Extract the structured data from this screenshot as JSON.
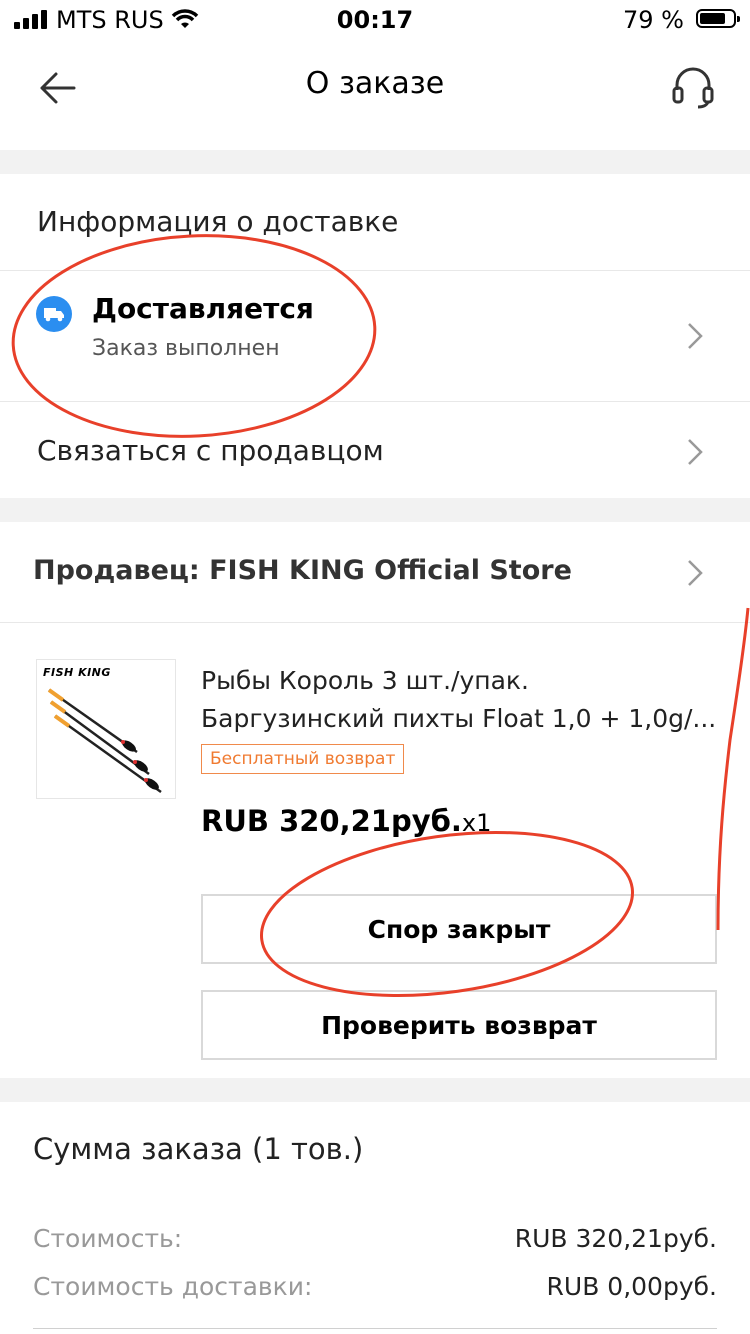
{
  "status_bar": {
    "carrier": "MTS RUS",
    "time": "00:17",
    "battery": "79 %",
    "battery_level": 0.79
  },
  "header": {
    "title": "О заказе",
    "back_icon": "arrow-left-icon",
    "support_icon": "headset-icon"
  },
  "delivery": {
    "section_title": "Информация о доставке",
    "status": "Доставляется",
    "status_sub": "Заказ выполнен",
    "status_icon": "truck-icon",
    "contact_seller": "Связаться с продавцом"
  },
  "seller": {
    "label": "Продавец: FISH KING Official Store"
  },
  "product": {
    "logo": "FISH KING",
    "name_line1": "Рыбы Король 3 шт./упак.",
    "name_line2": "Баргузинский пихты Float 1,0 + 1,0g/...",
    "free_return": "Бесплатный возврат",
    "price": "RUB 320,21руб.",
    "qty": "x1",
    "dispute_button": "Спор закрыт",
    "check_return_button": "Проверить возврат"
  },
  "summary": {
    "title": "Сумма заказа (1 тов.)",
    "rows": [
      {
        "label": "Стоимость:",
        "value": "RUB 320,21руб."
      },
      {
        "label": "Стоимость доставки:",
        "value": "RUB 0,00руб."
      }
    ]
  },
  "colors": {
    "accent_blue": "#2b8ef0",
    "return_orange": "#f07a30",
    "annotation_red": "#e8402a",
    "section_gap": "#f2f2f2"
  }
}
